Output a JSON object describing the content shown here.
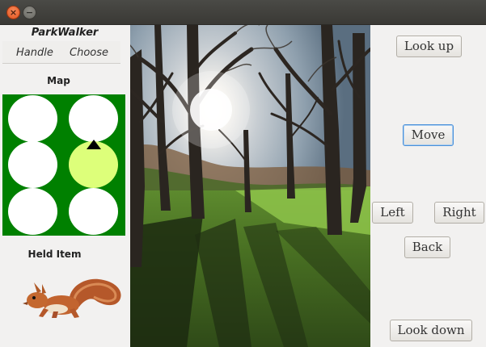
{
  "window": {
    "close_glyph": "×",
    "minimize_glyph": "−"
  },
  "sidebar": {
    "app_title": "ParkWalker",
    "menu": [
      "Handle",
      "Choose"
    ],
    "map_label": "Map",
    "held_item_label": "Held Item"
  },
  "map": {
    "rows": 3,
    "cols": 2,
    "active_cell": {
      "row": 1,
      "col": 1
    },
    "player_facing": "up"
  },
  "held_item": {
    "icon": "squirrel-icon"
  },
  "scene": {
    "icon": "park-trees-scene"
  },
  "controls": {
    "look_up": "Look up",
    "move": "Move",
    "left": "Left",
    "right": "Right",
    "back": "Back",
    "look_down": "Look down"
  },
  "colors": {
    "map_background": "#008000",
    "cell_empty": "#ffffff",
    "cell_current": "#ddff7a",
    "focus": "#4a90d9"
  }
}
